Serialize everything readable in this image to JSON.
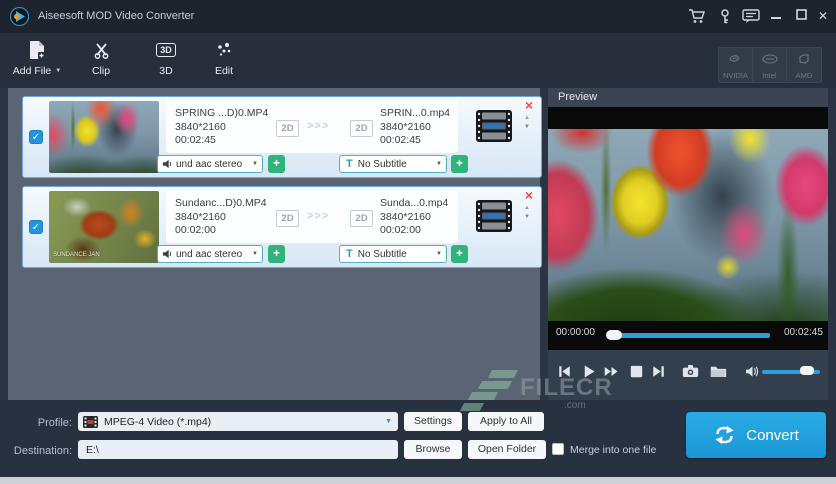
{
  "titlebar": {
    "title": "Aiseesoft MOD Video Converter"
  },
  "toolbar": {
    "items": [
      {
        "label": "Add File"
      },
      {
        "label": "Clip"
      },
      {
        "label": "3D"
      },
      {
        "label": "Edit"
      }
    ],
    "gpu": [
      "NVIDIA",
      "Intel",
      "AMD"
    ]
  },
  "icons": {
    "caret_down": "▼",
    "chain_arrows": ">>>",
    "plus": "+",
    "check": "✓",
    "close_x": "×",
    "up_arrow": "▲",
    "down_arrow": "▼",
    "subtitle_t": "T",
    "three_d_glyph": "3D",
    "window_close": "✕"
  },
  "file_list": [
    {
      "source_name": "SPRING ...D)0.MP4",
      "source_resolution": "3840*2160",
      "source_duration": "00:02:45",
      "source_dim": "2D",
      "target_dim": "2D",
      "target_name": "SPRIN...0.mp4",
      "target_resolution": "3840*2160",
      "target_duration": "00:02:45",
      "audio_track": "und aac stereo",
      "subtitle": "No Subtitle",
      "thumb_caption": ""
    },
    {
      "source_name": "Sundanc...D)0.MP4",
      "source_resolution": "3840*2160",
      "source_duration": "00:02:00",
      "source_dim": "2D",
      "target_dim": "2D",
      "target_name": "Sunda...0.mp4",
      "target_resolution": "3840*2160",
      "target_duration": "00:02:00",
      "audio_track": "und aac stereo",
      "subtitle": "No Subtitle",
      "thumb_caption": "SUNDANCE JAN"
    }
  ],
  "preview": {
    "title": "Preview",
    "current_time": "00:00:00",
    "total_time": "00:02:45",
    "progress_pct": 0,
    "volume_pct": 75
  },
  "footer": {
    "profile_label": "Profile:",
    "profile_value": "MPEG-4 Video (*.mp4)",
    "settings": "Settings",
    "apply_to_all": "Apply to All",
    "destination_label": "Destination:",
    "destination_value": "E:\\",
    "browse": "Browse",
    "open_folder": "Open Folder",
    "merge_label": "Merge into one file",
    "convert": "Convert"
  },
  "watermark": {
    "text": "FILECR",
    "domain": ".com"
  },
  "colors": {
    "accent_blue": "#2196dd",
    "convert_blue": "#1b97d6",
    "plus_green": "#2fb57c",
    "remove_red": "#e8503a",
    "row_border": "#6fa7d8",
    "select_border": "#4db3c4"
  }
}
